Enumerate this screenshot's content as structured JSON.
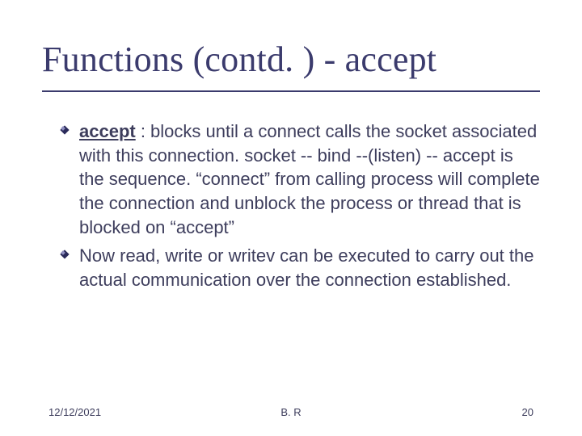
{
  "title": "Functions (contd. ) - accept",
  "bullets": [
    {
      "accept_label": "accept",
      "rest": " : blocks until a connect calls the socket associated with this connection. socket -- bind --(listen) -- accept is the sequence. “connect” from calling process will complete the connection and unblock the process or thread that is blocked on “accept”"
    },
    {
      "text": "Now read, write or writev can be executed to carry out the actual communication over the connection established."
    }
  ],
  "footer": {
    "date": "12/12/2021",
    "center": "B. R",
    "page": "20"
  }
}
